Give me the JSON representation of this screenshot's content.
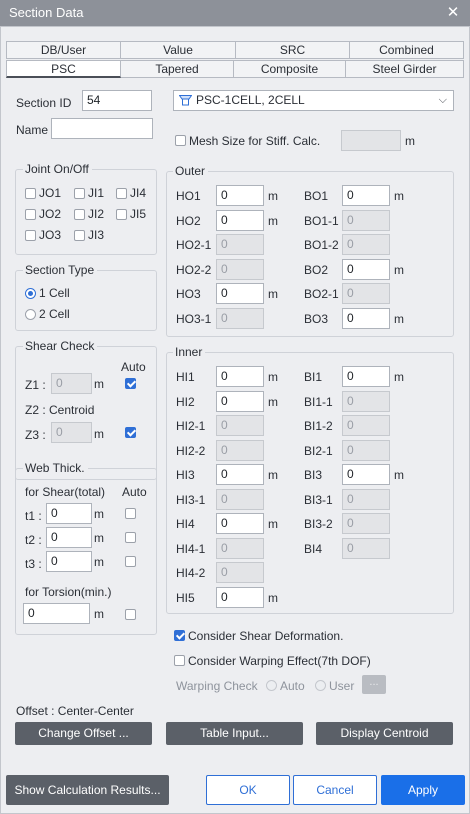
{
  "title": "Section Data",
  "tabs_row1": [
    "DB/User",
    "Value",
    "SRC",
    "Combined"
  ],
  "tabs_row2": [
    "PSC",
    "Tapered",
    "Composite",
    "Steel Girder"
  ],
  "section_id_label": "Section ID",
  "section_id": "54",
  "name_label": "Name",
  "name_value": "",
  "section_shape": "PSC-1CELL, 2CELL",
  "mesh_label": "Mesh Size for Stiff. Calc.",
  "mesh_unit": "m",
  "joint": {
    "title": "Joint On/Off",
    "items": [
      "JO1",
      "JI1",
      "JI4",
      "JO2",
      "JI2",
      "JI5",
      "JO3",
      "JI3"
    ]
  },
  "section_type": {
    "title": "Section Type",
    "options": [
      "1 Cell",
      "2 Cell"
    ],
    "selected": "1 Cell"
  },
  "shear_check": {
    "title": "Shear Check",
    "auto_label": "Auto",
    "z1_label": "Z1 :",
    "z1_value": "0",
    "z2_label": "Z2 :  Centroid",
    "z3_label": "Z3 :",
    "z3_value": "0",
    "unit": "m"
  },
  "web_thick": {
    "title": "Web Thick.",
    "shear_label": "for Shear(total)",
    "auto_label": "Auto",
    "t1_label": "t1 :",
    "t1_value": "0",
    "t2_label": "t2 :",
    "t2_value": "0",
    "t3_label": "t3 :",
    "t3_value": "0",
    "torsion_label": "for Torsion(min.)",
    "torsion_value": "0",
    "unit": "m"
  },
  "outer": {
    "title": "Outer",
    "unit": "m",
    "left": [
      {
        "label": "HO1",
        "value": "0",
        "enabled": true
      },
      {
        "label": "HO2",
        "value": "0",
        "enabled": true
      },
      {
        "label": "HO2-1",
        "value": "0",
        "enabled": false
      },
      {
        "label": "HO2-2",
        "value": "0",
        "enabled": false
      },
      {
        "label": "HO3",
        "value": "0",
        "enabled": true
      },
      {
        "label": "HO3-1",
        "value": "0",
        "enabled": false
      }
    ],
    "right": [
      {
        "label": "BO1",
        "value": "0",
        "enabled": true
      },
      {
        "label": "BO1-1",
        "value": "0",
        "enabled": false
      },
      {
        "label": "BO1-2",
        "value": "0",
        "enabled": false
      },
      {
        "label": "BO2",
        "value": "0",
        "enabled": true
      },
      {
        "label": "BO2-1",
        "value": "0",
        "enabled": false
      },
      {
        "label": "BO3",
        "value": "0",
        "enabled": true
      }
    ]
  },
  "inner": {
    "title": "Inner",
    "unit": "m",
    "left": [
      {
        "label": "HI1",
        "value": "0",
        "enabled": true
      },
      {
        "label": "HI2",
        "value": "0",
        "enabled": true
      },
      {
        "label": "HI2-1",
        "value": "0",
        "enabled": false
      },
      {
        "label": "HI2-2",
        "value": "0",
        "enabled": false
      },
      {
        "label": "HI3",
        "value": "0",
        "enabled": true
      },
      {
        "label": "HI3-1",
        "value": "0",
        "enabled": false
      },
      {
        "label": "HI4",
        "value": "0",
        "enabled": true
      },
      {
        "label": "HI4-1",
        "value": "0",
        "enabled": false
      },
      {
        "label": "HI4-2",
        "value": "0",
        "enabled": false
      },
      {
        "label": "HI5",
        "value": "0",
        "enabled": true
      }
    ],
    "right": [
      {
        "label": "BI1",
        "value": "0",
        "enabled": true
      },
      {
        "label": "BI1-1",
        "value": "0",
        "enabled": false
      },
      {
        "label": "BI1-2",
        "value": "0",
        "enabled": false
      },
      {
        "label": "BI2-1",
        "value": "0",
        "enabled": false
      },
      {
        "label": "BI3",
        "value": "0",
        "enabled": true
      },
      {
        "label": "BI3-1",
        "value": "0",
        "enabled": false
      },
      {
        "label": "BI3-2",
        "value": "0",
        "enabled": false
      },
      {
        "label": "BI4",
        "value": "0",
        "enabled": false
      }
    ]
  },
  "consider_shear": "Consider Shear Deformation.",
  "consider_warping": "Consider Warping Effect(7th DOF)",
  "warping_check": {
    "label": "Warping Check",
    "auto": "Auto",
    "user": "User",
    "dots": "..."
  },
  "offset_label": "Offset :  Center-Center",
  "buttons": {
    "change_offset": "Change Offset ...",
    "table_input": "Table Input...",
    "display_centroid": "Display Centroid",
    "show_results": "Show Calculation Results...",
    "ok": "OK",
    "cancel": "Cancel",
    "apply": "Apply"
  },
  "colors": {
    "accent": "#1a6fe8",
    "title_bar": "#8d9199",
    "dark_button": "#5b6068"
  }
}
